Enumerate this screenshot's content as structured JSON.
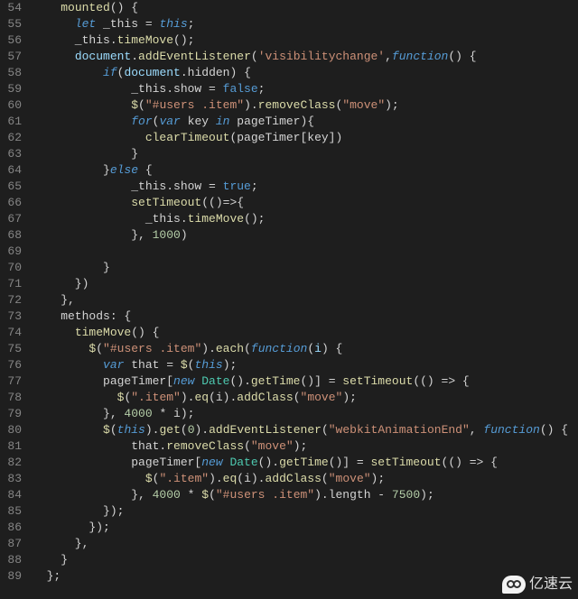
{
  "gutter": {
    "start": 54,
    "end": 89
  },
  "watermark": {
    "text": "亿速云"
  },
  "code": [
    [
      [
        "    ",
        ""
      ],
      [
        "mounted",
        "c-fnname"
      ],
      [
        "() {",
        ""
      ]
    ],
    [
      [
        "      ",
        ""
      ],
      [
        "let",
        "c-kw"
      ],
      [
        " _this = ",
        ""
      ],
      [
        "this",
        "c-this"
      ],
      [
        ";",
        ""
      ]
    ],
    [
      [
        "      _this.",
        ""
      ],
      [
        "timeMove",
        "c-fnname"
      ],
      [
        "();",
        ""
      ]
    ],
    [
      [
        "      ",
        ""
      ],
      [
        "document",
        "c-id"
      ],
      [
        ".",
        ""
      ],
      [
        "addEventListener",
        "c-fn"
      ],
      [
        "(",
        ""
      ],
      [
        "'visibilitychange'",
        "c-str"
      ],
      [
        ",",
        ""
      ],
      [
        "function",
        "c-kw"
      ],
      [
        "() {",
        ""
      ]
    ],
    [
      [
        "          ",
        ""
      ],
      [
        "if",
        "c-kw"
      ],
      [
        "(",
        ""
      ],
      [
        "document",
        "c-id"
      ],
      [
        ".hidden) {",
        ""
      ]
    ],
    [
      [
        "              _this.show = ",
        ""
      ],
      [
        "false",
        "c-bool"
      ],
      [
        ";",
        ""
      ]
    ],
    [
      [
        "              ",
        ""
      ],
      [
        "$",
        "c-fn"
      ],
      [
        "(",
        ""
      ],
      [
        "\"#users .item\"",
        "c-str"
      ],
      [
        ").",
        ""
      ],
      [
        "removeClass",
        "c-fn"
      ],
      [
        "(",
        ""
      ],
      [
        "\"move\"",
        "c-str"
      ],
      [
        ");",
        ""
      ]
    ],
    [
      [
        "              ",
        ""
      ],
      [
        "for",
        "c-kw"
      ],
      [
        "(",
        ""
      ],
      [
        "var",
        "c-kw"
      ],
      [
        " key ",
        ""
      ],
      [
        "in",
        "c-kw"
      ],
      [
        " pageTimer){",
        ""
      ]
    ],
    [
      [
        "                ",
        ""
      ],
      [
        "clearTimeout",
        "c-fn"
      ],
      [
        "(pageTimer[key])",
        ""
      ]
    ],
    [
      [
        "              }",
        ""
      ]
    ],
    [
      [
        "          }",
        ""
      ],
      [
        "else",
        "c-kw"
      ],
      [
        " {",
        ""
      ]
    ],
    [
      [
        "              _this.show = ",
        ""
      ],
      [
        "true",
        "c-bool"
      ],
      [
        ";",
        ""
      ]
    ],
    [
      [
        "              ",
        ""
      ],
      [
        "setTimeout",
        "c-fn"
      ],
      [
        "(()=>{",
        ""
      ]
    ],
    [
      [
        "                _this.",
        ""
      ],
      [
        "timeMove",
        "c-fnname"
      ],
      [
        "();",
        ""
      ]
    ],
    [
      [
        "              }, ",
        ""
      ],
      [
        "1000",
        "c-num"
      ],
      [
        ")",
        ""
      ]
    ],
    [
      [
        "          ",
        ""
      ]
    ],
    [
      [
        "          }",
        ""
      ]
    ],
    [
      [
        "      })",
        ""
      ]
    ],
    [
      [
        "    },",
        ""
      ]
    ],
    [
      [
        "    methods: {",
        ""
      ]
    ],
    [
      [
        "      ",
        ""
      ],
      [
        "timeMove",
        "c-fnname"
      ],
      [
        "() {",
        ""
      ]
    ],
    [
      [
        "        ",
        ""
      ],
      [
        "$",
        "c-fn"
      ],
      [
        "(",
        ""
      ],
      [
        "\"#users .item\"",
        "c-str"
      ],
      [
        ").",
        ""
      ],
      [
        "each",
        "c-fn"
      ],
      [
        "(",
        ""
      ],
      [
        "function",
        "c-kw"
      ],
      [
        "(",
        ""
      ],
      [
        "i",
        "c-id"
      ],
      [
        ") {",
        ""
      ]
    ],
    [
      [
        "          ",
        ""
      ],
      [
        "var",
        "c-kw"
      ],
      [
        " that = ",
        ""
      ],
      [
        "$",
        "c-fn"
      ],
      [
        "(",
        ""
      ],
      [
        "this",
        "c-this"
      ],
      [
        ");",
        ""
      ]
    ],
    [
      [
        "          pageTimer[",
        ""
      ],
      [
        "new",
        "c-kw"
      ],
      [
        " ",
        ""
      ],
      [
        "Date",
        "c-type"
      ],
      [
        "().",
        ""
      ],
      [
        "getTime",
        "c-fn"
      ],
      [
        "()] = ",
        ""
      ],
      [
        "setTimeout",
        "c-fn"
      ],
      [
        "(() => {",
        ""
      ]
    ],
    [
      [
        "            ",
        ""
      ],
      [
        "$",
        "c-fn"
      ],
      [
        "(",
        ""
      ],
      [
        "\".item\"",
        "c-str"
      ],
      [
        ").",
        ""
      ],
      [
        "eq",
        "c-fn"
      ],
      [
        "(i).",
        ""
      ],
      [
        "addClass",
        "c-fn"
      ],
      [
        "(",
        ""
      ],
      [
        "\"move\"",
        "c-str"
      ],
      [
        ");",
        ""
      ]
    ],
    [
      [
        "          }, ",
        ""
      ],
      [
        "4000",
        "c-num"
      ],
      [
        " * i);",
        ""
      ]
    ],
    [
      [
        "          ",
        ""
      ],
      [
        "$",
        "c-fn"
      ],
      [
        "(",
        ""
      ],
      [
        "this",
        "c-this"
      ],
      [
        ").",
        ""
      ],
      [
        "get",
        "c-fn"
      ],
      [
        "(",
        ""
      ],
      [
        "0",
        "c-num"
      ],
      [
        ").",
        ""
      ],
      [
        "addEventListener",
        "c-fn"
      ],
      [
        "(",
        ""
      ],
      [
        "\"webkitAnimationEnd\"",
        "c-str"
      ],
      [
        ", ",
        ""
      ],
      [
        "function",
        "c-kw"
      ],
      [
        "() {",
        ""
      ]
    ],
    [
      [
        "              that.",
        ""
      ],
      [
        "removeClass",
        "c-fn"
      ],
      [
        "(",
        ""
      ],
      [
        "\"move\"",
        "c-str"
      ],
      [
        ");",
        ""
      ]
    ],
    [
      [
        "              pageTimer[",
        ""
      ],
      [
        "new",
        "c-kw"
      ],
      [
        " ",
        ""
      ],
      [
        "Date",
        "c-type"
      ],
      [
        "().",
        ""
      ],
      [
        "getTime",
        "c-fn"
      ],
      [
        "()] = ",
        ""
      ],
      [
        "setTimeout",
        "c-fn"
      ],
      [
        "(() => {",
        ""
      ]
    ],
    [
      [
        "                ",
        ""
      ],
      [
        "$",
        "c-fn"
      ],
      [
        "(",
        ""
      ],
      [
        "\".item\"",
        "c-str"
      ],
      [
        ").",
        ""
      ],
      [
        "eq",
        "c-fn"
      ],
      [
        "(i).",
        ""
      ],
      [
        "addClass",
        "c-fn"
      ],
      [
        "(",
        ""
      ],
      [
        "\"move\"",
        "c-str"
      ],
      [
        ");",
        ""
      ]
    ],
    [
      [
        "              }, ",
        ""
      ],
      [
        "4000",
        "c-num"
      ],
      [
        " * ",
        ""
      ],
      [
        "$",
        "c-fn"
      ],
      [
        "(",
        ""
      ],
      [
        "\"#users .item\"",
        "c-str"
      ],
      [
        ").length - ",
        ""
      ],
      [
        "7500",
        "c-num"
      ],
      [
        ");",
        ""
      ]
    ],
    [
      [
        "          });",
        ""
      ]
    ],
    [
      [
        "        });",
        ""
      ]
    ],
    [
      [
        "      },",
        ""
      ]
    ],
    [
      [
        "    }",
        ""
      ]
    ],
    [
      [
        "  };",
        ""
      ]
    ]
  ]
}
